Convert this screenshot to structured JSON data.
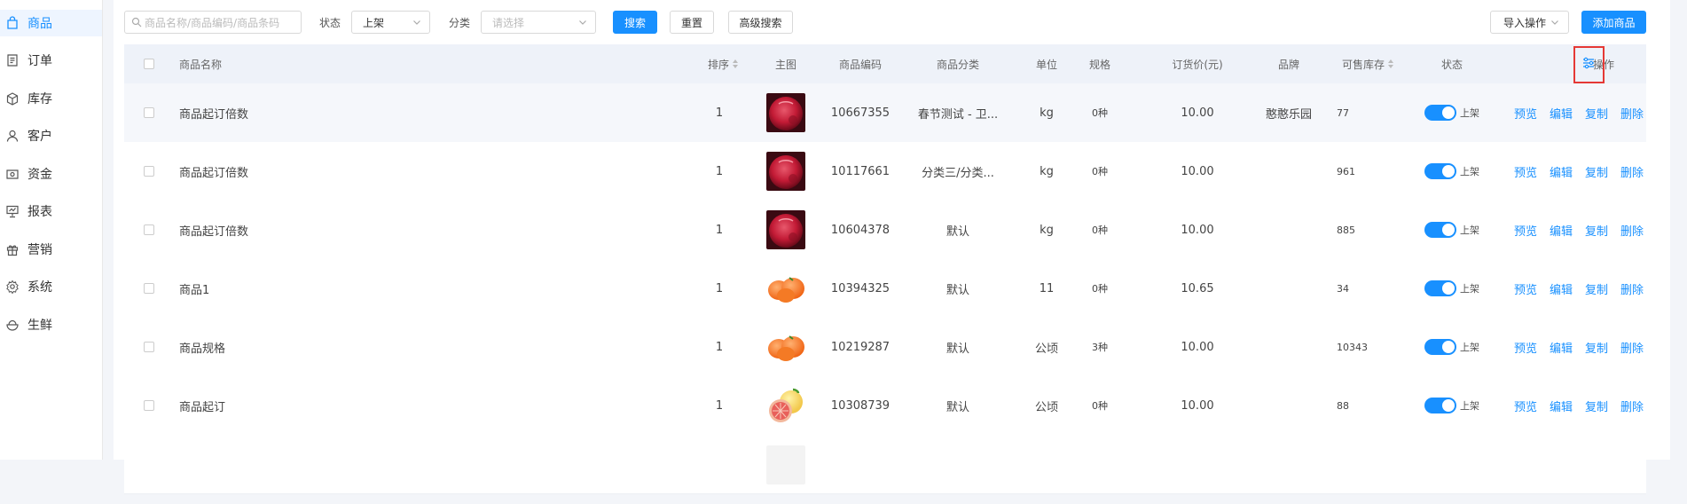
{
  "sidebar": {
    "items": [
      {
        "label": "商品",
        "icon": "bag-icon",
        "active": true
      },
      {
        "label": "订单",
        "icon": "document-icon"
      },
      {
        "label": "库存",
        "icon": "box-icon"
      },
      {
        "label": "客户",
        "icon": "user-icon"
      },
      {
        "label": "资金",
        "icon": "wallet-icon"
      },
      {
        "label": "报表",
        "icon": "chart-board-icon"
      },
      {
        "label": "营销",
        "icon": "gift-icon"
      },
      {
        "label": "系统",
        "icon": "gear-icon"
      },
      {
        "label": "生鲜",
        "icon": "bowl-icon"
      }
    ]
  },
  "toolbar": {
    "search_placeholder": "商品名称/商品编码/商品条码",
    "status_label": "状态",
    "status_value": "上架",
    "category_label": "分类",
    "category_placeholder": "请选择",
    "search_button": "搜索",
    "reset_button": "重置",
    "advanced_button": "高级搜索",
    "import_button": "导入操作",
    "add_button": "添加商品"
  },
  "table": {
    "headers": {
      "name": "商品名称",
      "sort": "排序",
      "image": "主图",
      "code": "商品编码",
      "category": "商品分类",
      "unit": "单位",
      "spec": "规格",
      "price": "订货价(元)",
      "brand": "品牌",
      "stock": "可售库存",
      "status": "状态",
      "actions": "操作"
    },
    "action_labels": {
      "preview": "预览",
      "edit": "编辑",
      "copy": "复制",
      "delete": "删除"
    },
    "rows": [
      {
        "name": "商品起订倍数",
        "sort": "1",
        "image": "red-fruit",
        "code": "10667355",
        "category": "春节测试 - 卫...",
        "unit": "kg",
        "spec": "0种",
        "price": "10.00",
        "brand": "憨憨乐园",
        "stock": "77",
        "status": "上架"
      },
      {
        "name": "商品起订倍数",
        "sort": "1",
        "image": "red-fruit",
        "code": "10117661",
        "category": "分类三/分类...",
        "unit": "kg",
        "spec": "0种",
        "price": "10.00",
        "brand": "",
        "stock": "961",
        "status": "上架"
      },
      {
        "name": "商品起订倍数",
        "sort": "1",
        "image": "red-fruit",
        "code": "10604378",
        "category": "默认",
        "unit": "kg",
        "spec": "0种",
        "price": "10.00",
        "brand": "",
        "stock": "885",
        "status": "上架"
      },
      {
        "name": "商品1",
        "sort": "1",
        "image": "orange-fruit",
        "code": "10394325",
        "category": "默认",
        "unit": "11",
        "spec": "0种",
        "price": "10.65",
        "brand": "",
        "stock": "34",
        "status": "上架"
      },
      {
        "name": "商品规格",
        "sort": "1",
        "image": "orange-fruit",
        "code": "10219287",
        "category": "默认",
        "unit": "公顷",
        "spec": "3种",
        "price": "10.00",
        "brand": "",
        "stock": "10343",
        "status": "上架"
      },
      {
        "name": "商品起订",
        "sort": "1",
        "image": "grapefruit",
        "code": "10308739",
        "category": "默认",
        "unit": "公顷",
        "spec": "0种",
        "price": "10.00",
        "brand": "",
        "stock": "88",
        "status": "上架"
      }
    ]
  }
}
